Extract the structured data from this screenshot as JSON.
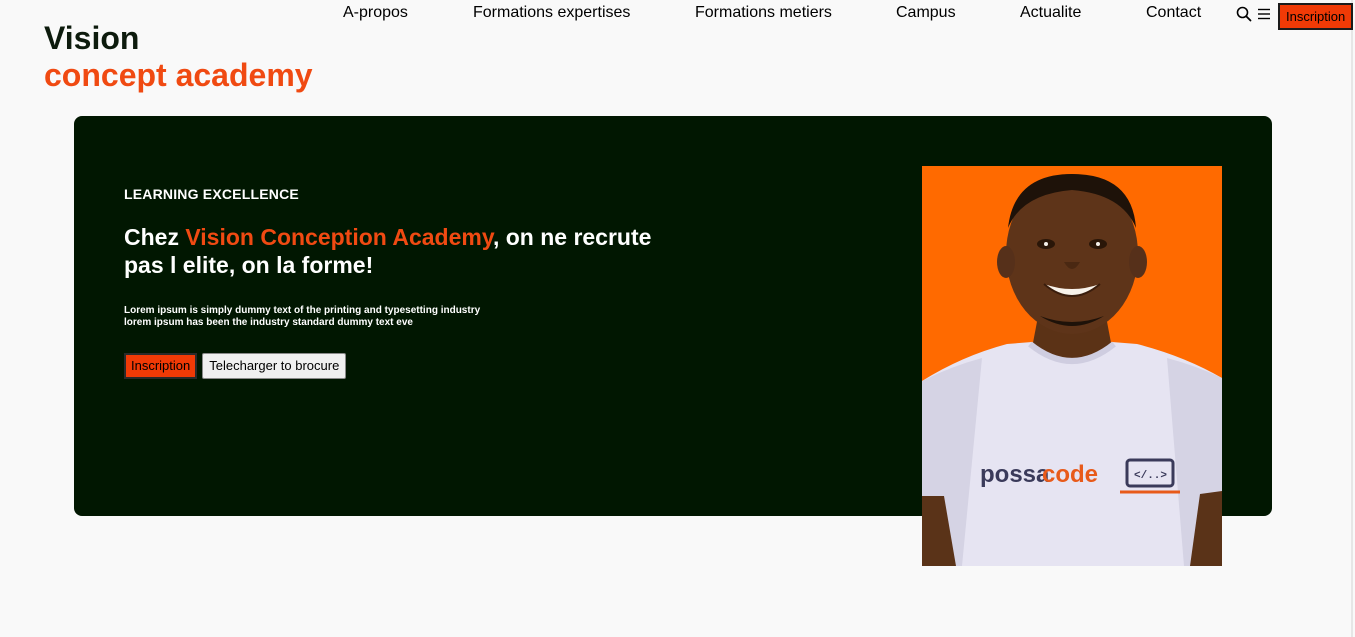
{
  "brand": {
    "line1": "Vision",
    "line2": "concept academy"
  },
  "nav": {
    "items": [
      "A-propos",
      "Formations expertises",
      "Formations metiers",
      "Campus",
      "Actualite",
      "Contact"
    ],
    "search_icon": "search-icon",
    "menu_icon": "menu-icon",
    "cta_label": "Inscription"
  },
  "hero": {
    "kicker": "LEARNING EXCELLENCE",
    "headline_pre": "Chez ",
    "headline_accent": "Vision Conception Academy",
    "headline_post": ", on ne recrute pas l elite, on la forme!",
    "desc_line1": "Lorem ipsum is simply dummy text of the printing and typesetting industry",
    "desc_line2": "lorem ipsum has been the industry standard dummy text eve",
    "primary_label": "Inscription",
    "secondary_label": "Telecharger to brocure",
    "photo_shirt_text": "possacode",
    "photo_shirt_code": "</..>"
  },
  "colors": {
    "accent": "#f04a12",
    "button": "#f03a06",
    "hero_bg": "#011701",
    "photo_bg": "#ff6a00"
  }
}
